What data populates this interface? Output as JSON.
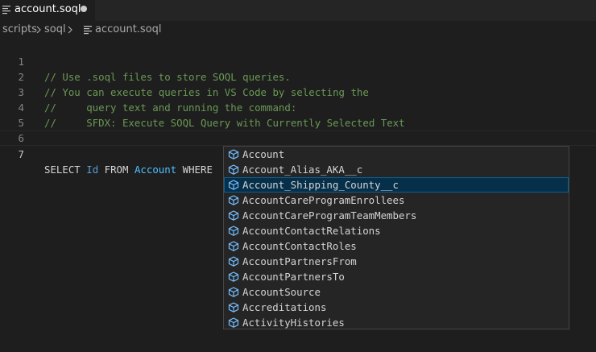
{
  "tab": {
    "label": "account.soql",
    "file_icon": "file-lines-icon",
    "dirty_icon": "unsaved-dot-icon"
  },
  "breadcrumb": {
    "items": [
      "scripts",
      "soql",
      "account.soql"
    ],
    "separator_icon": "chevron-right-icon",
    "file_icon": "file-lines-icon"
  },
  "editor": {
    "lines": [
      {
        "number": "1",
        "text": "// Use .soql files to store SOQL queries."
      },
      {
        "number": "2",
        "text": "// You can execute queries in VS Code by selecting the"
      },
      {
        "number": "3",
        "text": "//     query text and running the command:"
      },
      {
        "number": "4",
        "text": "//     SFDX: Execute SOQL Query with Currently Selected Text"
      },
      {
        "number": "5",
        "text": ""
      },
      {
        "number": "6",
        "text": ""
      },
      {
        "number": "7",
        "tokens": {
          "select": "SELECT",
          "field": "Id",
          "from": "FROM",
          "object": "Account",
          "where": "WHERE"
        }
      }
    ]
  },
  "suggestions": {
    "item_icon": "cube-icon",
    "selected_index": 2,
    "items": [
      "Account",
      "Account_Alias_AKA__c",
      "Account_Shipping_County__c",
      "AccountCareProgramEnrollees",
      "AccountCareProgramTeamMembers",
      "AccountContactRelations",
      "AccountContactRoles",
      "AccountPartnersFrom",
      "AccountPartnersTo",
      "AccountSource",
      "Accreditations",
      "ActivityHistories"
    ]
  },
  "colors": {
    "background": "#1e1e1e",
    "comment": "#6a9955",
    "field": "#569cd6",
    "object": "#4fc1ff",
    "suggest_icon": "#75beff",
    "selected_row": "#062f4a"
  }
}
